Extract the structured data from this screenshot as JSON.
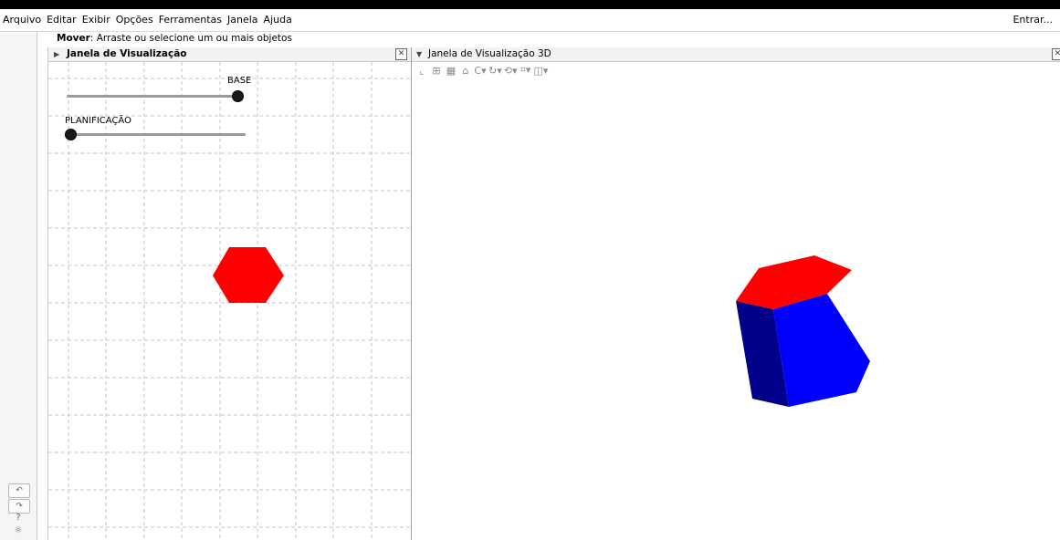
{
  "menubar": {
    "items": [
      "Arquivo",
      "Editar",
      "Exibir",
      "Opções",
      "Ferramentas",
      "Janela",
      "Ajuda"
    ],
    "signin": "Entrar..."
  },
  "mode_hint": {
    "tool": "Mover",
    "text": ": Arraste ou selecione um ou mais objetos"
  },
  "left_rail": {
    "undo": "↶",
    "redo": "↷",
    "help": "?",
    "settings": "☼"
  },
  "graphics_view": {
    "title": "Janela de Visualização",
    "sliders": [
      {
        "label": "BASE",
        "value_fraction": 1.0
      },
      {
        "label": "PLANIFICAÇÃO",
        "value_fraction": 0.0
      }
    ],
    "hexagon_color": "#ff0000"
  },
  "graphics_view_3d": {
    "title": "Janela de Visualização 3D",
    "toolbar_icons": [
      "axes-icon",
      "grid-icon",
      "plane-icon",
      "home-icon",
      "view-direction-icon",
      "rotate-icon",
      "rotate-view-icon",
      "clipping-icon",
      "projection-icon"
    ],
    "prism_top_color": "#ff0000",
    "prism_side_color": "#0000ff",
    "prism_dark_color": "#00008b"
  }
}
